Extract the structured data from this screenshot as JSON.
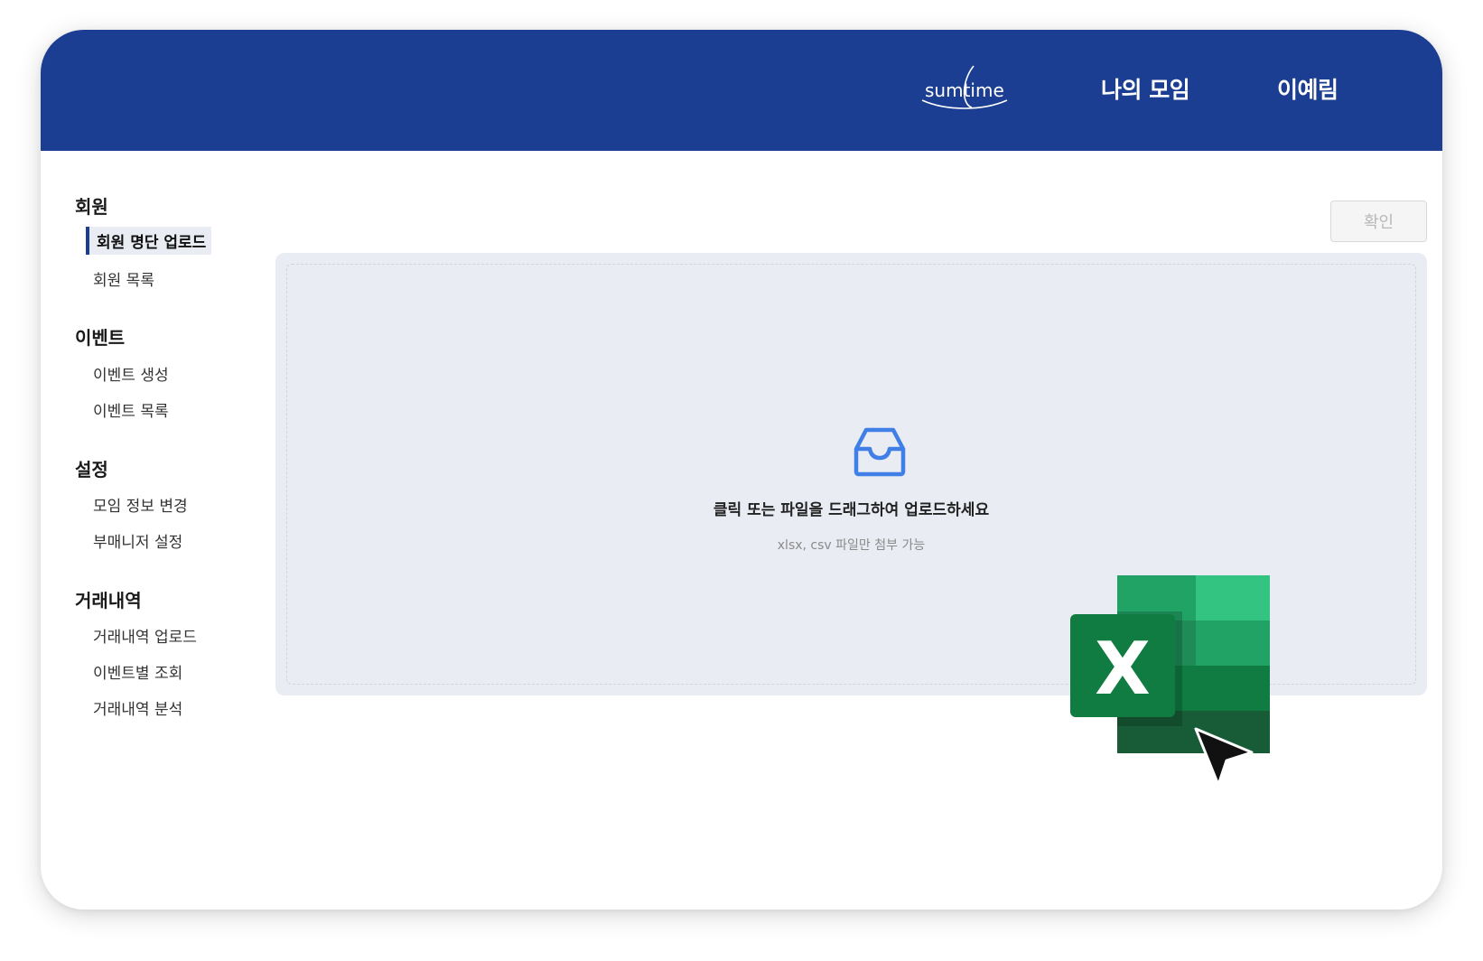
{
  "header": {
    "logo_text": "sumtime",
    "nav_my_group": "나의 모임",
    "nav_user": "이예림",
    "colors": {
      "primary": "#1b3d92"
    }
  },
  "sidebar": {
    "sections": [
      {
        "title": "회원",
        "items": [
          "회원 명단 업로드",
          "회원 목록"
        ]
      },
      {
        "title": "이벤트",
        "items": [
          "이벤트 생성",
          "이벤트 목록"
        ]
      },
      {
        "title": "설정",
        "items": [
          "모임 정보 변경",
          "부매니저 설정"
        ]
      },
      {
        "title": "거래내역",
        "items": [
          "거래내역 업로드",
          "이벤트별 조회",
          "거래내역 분석"
        ]
      }
    ],
    "active_item": "회원 명단 업로드"
  },
  "main": {
    "confirm_label": "확인",
    "upload_icon": "inbox-icon",
    "upload_main_text": "클릭 또는 파일을 드래그하여 업로드하세요",
    "upload_hint_text": "xlsx, csv 파일만 첨부 가능",
    "drag_file_icon": "excel-icon",
    "drag_file_letter": "X",
    "pointer_icon": "cursor-arrow-icon"
  }
}
